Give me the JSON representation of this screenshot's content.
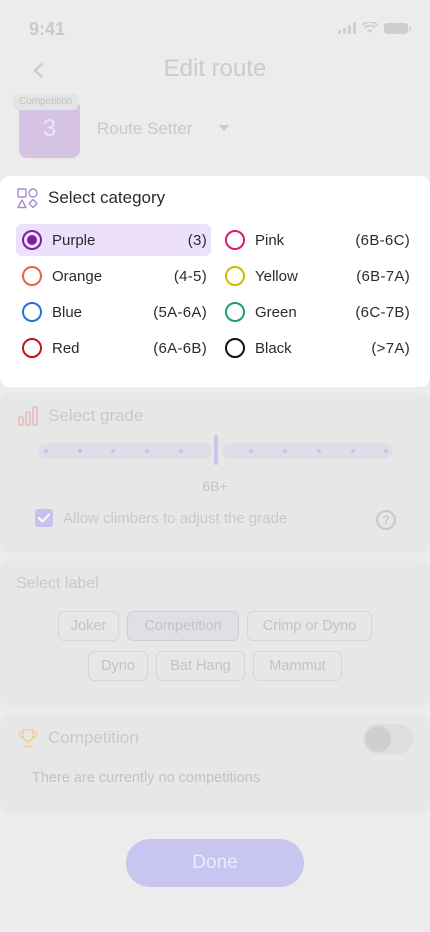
{
  "status": {
    "time": "9:41"
  },
  "header": {
    "title": "Edit route",
    "back_icon": "chevron-left-icon"
  },
  "setter": {
    "grade_number": "3",
    "badge": "Competition",
    "select_value": "Route Setter",
    "tile_color": "#d6c2e2"
  },
  "category": {
    "title": "Select category",
    "icon": "shapes-icon",
    "selected": "Purple",
    "items": [
      {
        "name": "Purple",
        "range": "(3)",
        "color": "#7b1fa2"
      },
      {
        "name": "Pink",
        "range": "(6B-6C)",
        "color": "#d81b7a"
      },
      {
        "name": "Orange",
        "range": "(4-5)",
        "color": "#e8643c"
      },
      {
        "name": "Yellow",
        "range": "(6B-7A)",
        "color": "#d4b800"
      },
      {
        "name": "Blue",
        "range": "(5A-6A)",
        "color": "#2a6fd6"
      },
      {
        "name": "Green",
        "range": "(6C-7B)",
        "color": "#1a9e72"
      },
      {
        "name": "Red",
        "range": "(6A-6B)",
        "color": "#c0151f"
      },
      {
        "name": "Black",
        "range": "(>7A)",
        "color": "#111111"
      }
    ]
  },
  "grade": {
    "title": "Select grade",
    "icon": "bar-chart-icon",
    "value": "6B+",
    "allow_label": "Allow climbers to adjust the grade",
    "allow_checked": true,
    "help_icon": "help-circle-icon",
    "help_glyph": "?"
  },
  "labels": {
    "title": "Select label",
    "selected": "Competition",
    "chips": [
      "Joker",
      "Competition",
      "Crimp or Dyno",
      "Dyno",
      "Bat Hang",
      "Mammut"
    ]
  },
  "competition": {
    "title": "Competition",
    "icon": "trophy-icon",
    "toggle_on": false,
    "empty_text": "There are currently no competitions"
  },
  "done_label": "Done",
  "colors": {
    "accent": "#c8c5f1",
    "selected_bg": "#ece0fb"
  }
}
